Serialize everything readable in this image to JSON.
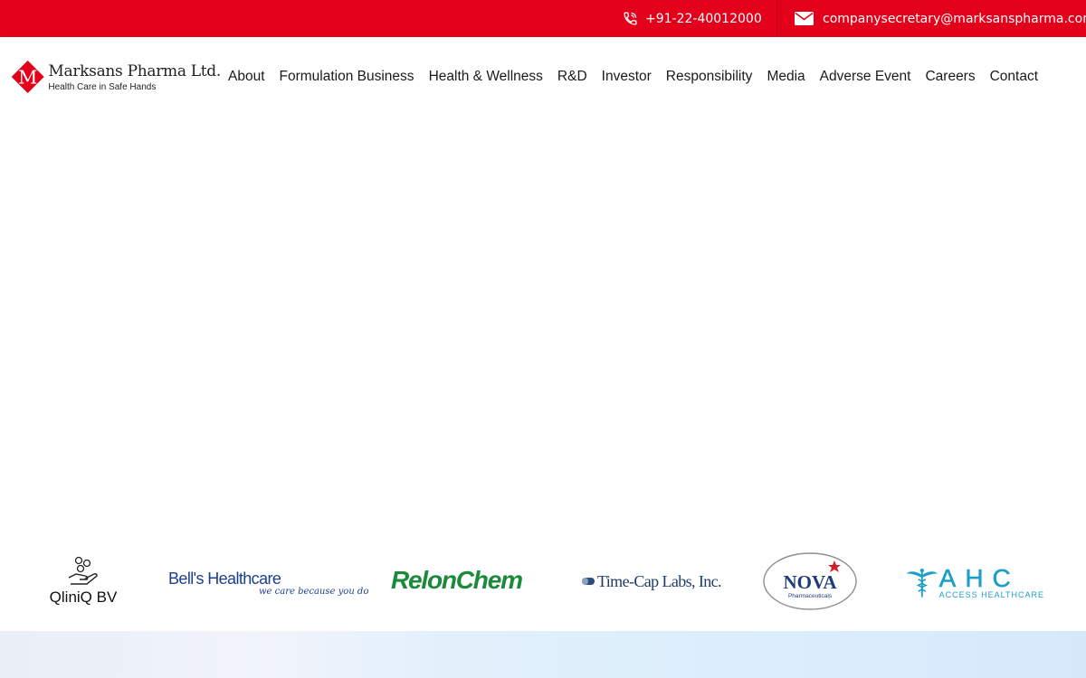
{
  "topbar": {
    "phone": "+91-22-40012000",
    "email": "companysecretary@marksanspharma.com",
    "phone_icon": "phone-icon",
    "email_icon": "envelope-icon",
    "bg_color": "#e3001b"
  },
  "brand": {
    "name": "Marksans Pharma Ltd.",
    "tagline": "Health Care in Safe Hands",
    "logo_letter": "M",
    "accent_color": "#e3001b"
  },
  "nav": {
    "items": [
      "About",
      "Formulation Business",
      "Health & Wellness",
      "R&D",
      "Investor",
      "Responsibility",
      "Media",
      "Adverse Event",
      "Careers",
      "Contact"
    ]
  },
  "partners": {
    "qliniq": "QliniQ BV",
    "bells_main": "Bell's Healthcare",
    "bells_tag": "we care because you do",
    "relonchem": "RelonChem",
    "timecap": "Time-Cap Labs, Inc.",
    "nova": "NOVA",
    "nova_sub": "Pharmaceuticals",
    "ahc": "AHC",
    "ahc_sub": "ACCESS HEALTHCARE"
  }
}
